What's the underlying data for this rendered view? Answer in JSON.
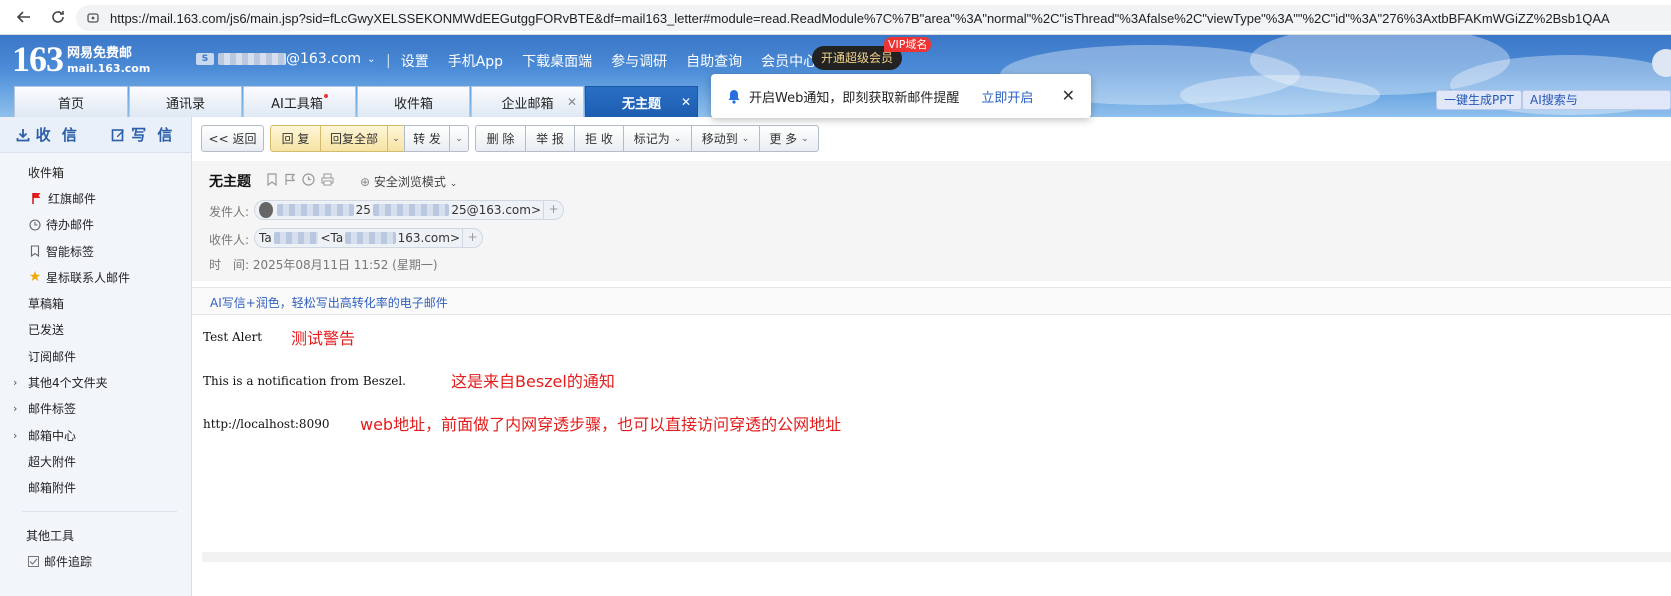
{
  "browser": {
    "url": "https://mail.163.com/js6/main.jsp?sid=fLcGwyXELSSEKONMWdEEGutggFORvBTE&df=mail163_letter#module=read.ReadModule%7C%7B\"area\"%3A\"normal\"%2C\"isThread\"%3Afalse%2C\"viewType\"%3A\"\"%2C\"id\"%3A\"276%3AxtbBFAKmWGiZZ%2Bsb1QAA"
  },
  "header": {
    "logo_num": "163",
    "logo_cn": "网易免费邮",
    "logo_en": "mail.163.com",
    "account_suffix": "@163.com",
    "links": [
      "设置",
      "手机App",
      "下载桌面端",
      "参与调研",
      "自助查询",
      "会员中心"
    ],
    "vip_button": "开通超级会员",
    "vip_tag": "VIP域名"
  },
  "tabs": [
    {
      "label": "首页"
    },
    {
      "label": "通讯录"
    },
    {
      "label": "AI工具箱"
    },
    {
      "label": "收件箱"
    },
    {
      "label": "企业邮箱"
    },
    {
      "label": "无主题"
    }
  ],
  "right_buttons": [
    "一键生成PPT",
    "AI搜索与"
  ],
  "notification": {
    "text": "开启Web通知，即刻获取新邮件提醒",
    "action": "立即开启"
  },
  "sidebar": {
    "receive": "收 信",
    "compose": "写 信",
    "folders": [
      "收件箱",
      "红旗邮件",
      "待办邮件",
      "智能标签",
      "星标联系人邮件",
      "草稿箱",
      "已发送",
      "订阅邮件",
      "其他4个文件夹",
      "邮件标签",
      "邮箱中心",
      "超大附件",
      "邮箱附件"
    ],
    "tools_title": "其他工具",
    "tools_item": "邮件追踪"
  },
  "toolbar": {
    "back": "<< 返回",
    "reply": "回 复",
    "reply_all": "回复全部",
    "forward": "转 发",
    "delete": "删 除",
    "report": "举 报",
    "reject": "拒 收",
    "mark_as": "标记为",
    "move_to": "移动到",
    "more": "更 多"
  },
  "mail": {
    "subject": "无主题",
    "safe_mode": "安全浏览模式",
    "from_label": "发件人:",
    "from_mid": "25",
    "from_suffix": "25@163.com>",
    "to_label": "收件人:",
    "to_prefix": "Ta",
    "to_mid": "<Ta",
    "to_suffix": "163.com>",
    "time_label": "时　间:",
    "time_value": "2025年08月11日 11:52 (星期一)",
    "ai_hint": "AI写信+润色，轻松写出高转化率的电子邮件"
  },
  "body": {
    "line1": "Test Alert",
    "annot1": "测试警告",
    "line2": "This is a notification from Beszel.",
    "annot2": "这是来自Beszel的通知",
    "line3": "http://localhost:8090",
    "annot3": "web地址，前面做了内网穿透步骤，也可以直接访问穿透的公网地址"
  }
}
